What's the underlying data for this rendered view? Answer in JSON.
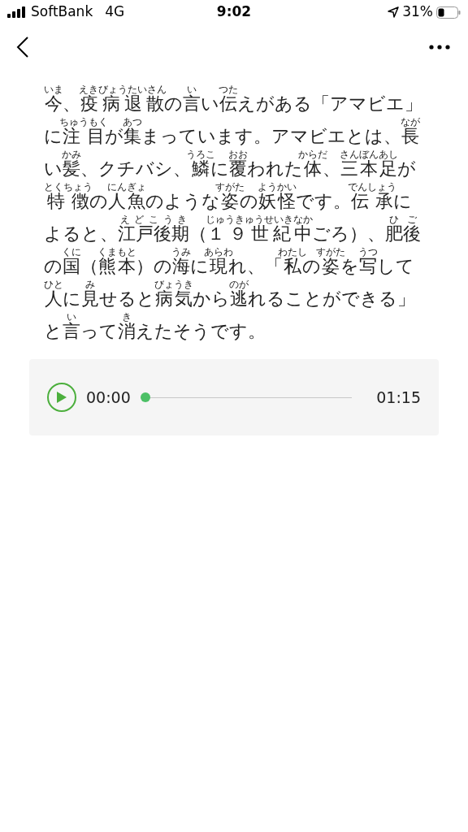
{
  "status_bar": {
    "carrier": "SoftBank",
    "network": "4G",
    "time": "9:02",
    "battery": "31%"
  },
  "article": {
    "segments": [
      {
        "text": "今",
        "ruby": "いま"
      },
      {
        "text": "、"
      },
      {
        "text": "疫病退散",
        "ruby": "えきびょうたいさん"
      },
      {
        "text": "の"
      },
      {
        "text": "言",
        "ruby": "い"
      },
      {
        "text": "い"
      },
      {
        "text": "伝",
        "ruby": "つた"
      },
      {
        "text": "えがある「アマビエ」に"
      },
      {
        "text": "注目",
        "ruby": "ちゅうもく"
      },
      {
        "text": "が"
      },
      {
        "text": "集",
        "ruby": "あつ"
      },
      {
        "text": "まっています。アマビエとは、"
      },
      {
        "text": "長",
        "ruby": "なが"
      },
      {
        "text": "い"
      },
      {
        "text": "髪",
        "ruby": "かみ"
      },
      {
        "text": "、クチバシ、"
      },
      {
        "text": "鱗",
        "ruby": "うろこ"
      },
      {
        "text": "に"
      },
      {
        "text": "覆",
        "ruby": "おお"
      },
      {
        "text": "われた"
      },
      {
        "text": "体",
        "ruby": "からだ"
      },
      {
        "text": "、"
      },
      {
        "text": "三本足",
        "ruby": "さんぼんあし"
      },
      {
        "text": "が"
      },
      {
        "text": "特徴",
        "ruby": "とくちょう"
      },
      {
        "text": "の"
      },
      {
        "text": "人魚",
        "ruby": "にんぎょ"
      },
      {
        "text": "のような"
      },
      {
        "text": "姿",
        "ruby": "すがた"
      },
      {
        "text": "の"
      },
      {
        "text": "妖怪",
        "ruby": "ようかい"
      },
      {
        "text": "です。"
      },
      {
        "text": "伝承",
        "ruby": "でんしょう"
      },
      {
        "text": "によると、"
      },
      {
        "text": "江戸後期",
        "ruby": "えどこうき"
      },
      {
        "text": "（"
      },
      {
        "text": "１９世紀",
        "ruby": "じゅうきゅうせいき"
      },
      {
        "text": "中",
        "ruby": "なか"
      },
      {
        "text": "ごろ）、"
      },
      {
        "text": "肥後",
        "ruby": "ひご"
      },
      {
        "text": "の"
      },
      {
        "text": "国",
        "ruby": "くに"
      },
      {
        "text": "（"
      },
      {
        "text": "熊本",
        "ruby": "くまもと"
      },
      {
        "text": "）の"
      },
      {
        "text": "海",
        "ruby": "うみ"
      },
      {
        "text": "に"
      },
      {
        "text": "現",
        "ruby": "あらわ"
      },
      {
        "text": "れ、「"
      },
      {
        "text": "私",
        "ruby": "わたし"
      },
      {
        "text": "の"
      },
      {
        "text": "姿",
        "ruby": "すがた"
      },
      {
        "text": "を"
      },
      {
        "text": "写",
        "ruby": "うつ"
      },
      {
        "text": "して"
      },
      {
        "text": "人",
        "ruby": "ひと"
      },
      {
        "text": "に"
      },
      {
        "text": "見",
        "ruby": "み"
      },
      {
        "text": "せると"
      },
      {
        "text": "病気",
        "ruby": "びょうき"
      },
      {
        "text": "から"
      },
      {
        "text": "逃",
        "ruby": "のが"
      },
      {
        "text": "れることができる」と"
      },
      {
        "text": "言",
        "ruby": "い"
      },
      {
        "text": "って"
      },
      {
        "text": "消",
        "ruby": "き"
      },
      {
        "text": "えたそうです。"
      }
    ]
  },
  "player": {
    "elapsed": "00:00",
    "level": 0,
    "duration": "01:15"
  }
}
